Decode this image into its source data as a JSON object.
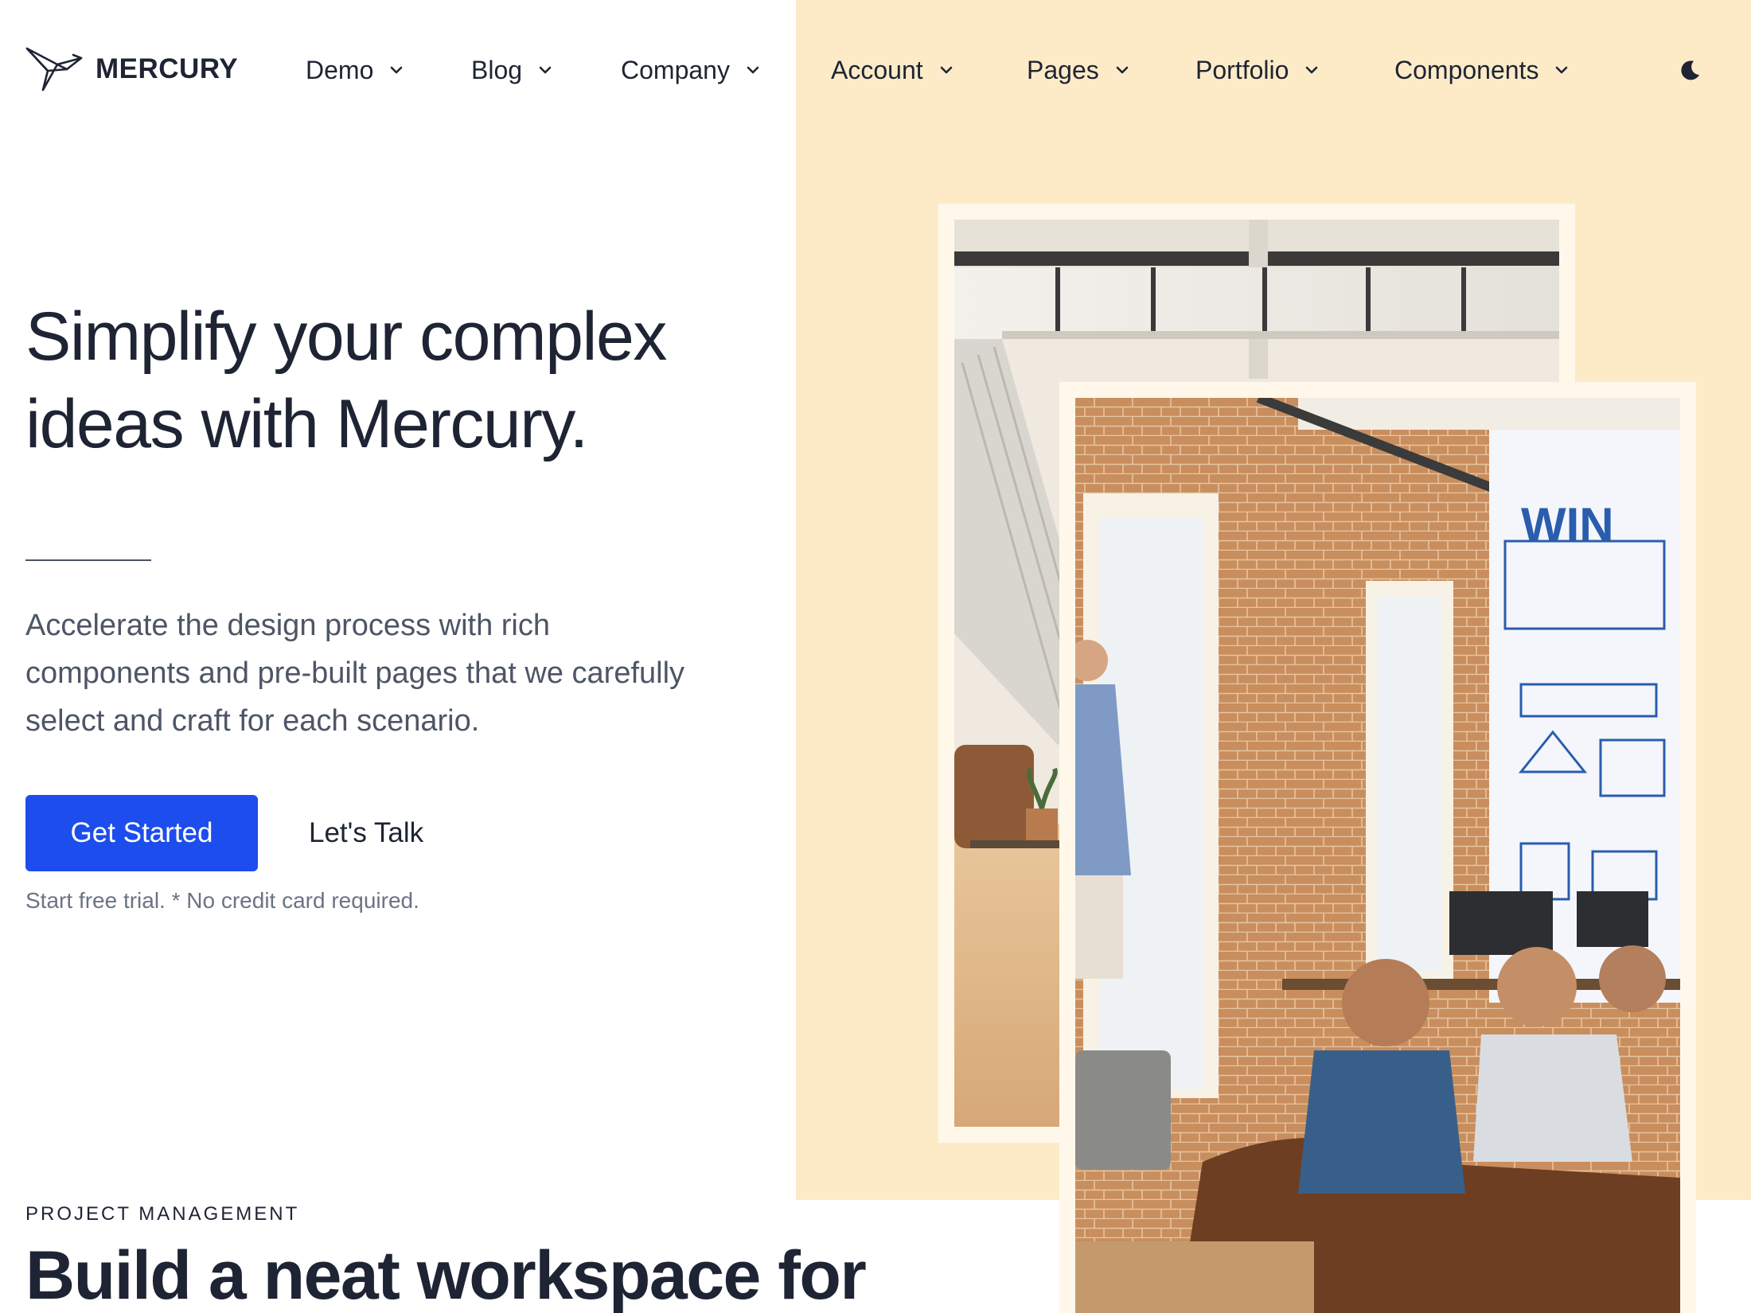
{
  "brand": {
    "name": "MERCURY",
    "logo_icon": "bird-logo-icon"
  },
  "nav": {
    "items": [
      {
        "label": "Demo",
        "icon": "chevron-down-icon"
      },
      {
        "label": "Blog",
        "icon": "chevron-down-icon"
      },
      {
        "label": "Company",
        "icon": "chevron-down-icon"
      },
      {
        "label": "Account",
        "icon": "chevron-down-icon"
      },
      {
        "label": "Pages",
        "icon": "chevron-down-icon"
      },
      {
        "label": "Portfolio",
        "icon": "chevron-down-icon"
      },
      {
        "label": "Components",
        "icon": "chevron-down-icon"
      }
    ],
    "theme_toggle_icon": "moon-icon"
  },
  "hero": {
    "title_line1": "Simplify your complex",
    "title_line2": "ideas with Mercury.",
    "lead_line1": "Accelerate the design process with rich",
    "lead_line2": "components and pre-built pages that we carefully",
    "lead_line3": "select and craft for each scenario.",
    "primary_cta": "Get Started",
    "secondary_cta": "Let's Talk",
    "note": "Start free trial. * No credit card required."
  },
  "section": {
    "eyebrow": "PROJECT MANAGEMENT",
    "title": "Build a neat workspace for"
  },
  "colors": {
    "accent": "#1d4ded",
    "hero_bg": "#fdebc8",
    "text": "#1e2433",
    "muted": "#4d5566"
  }
}
